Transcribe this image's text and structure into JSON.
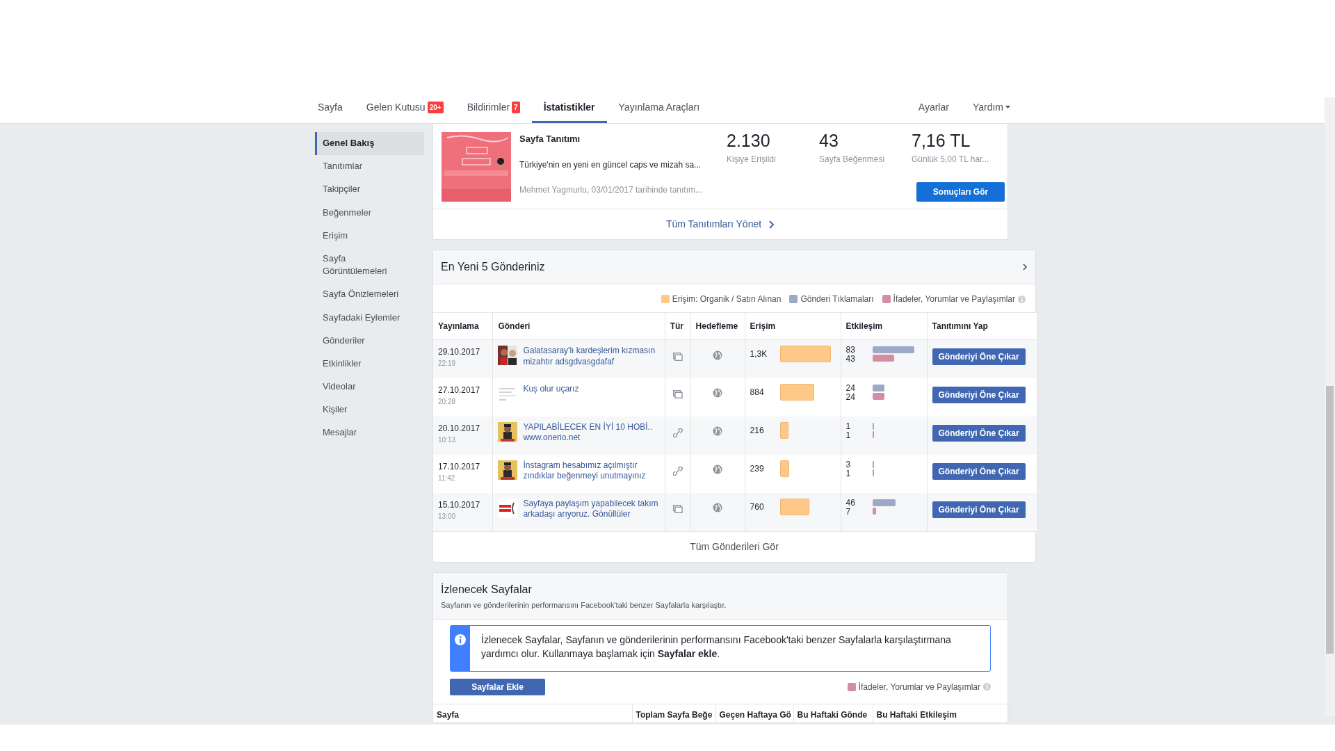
{
  "nav": {
    "tabs": [
      {
        "label": "Sayfa",
        "selected": false
      },
      {
        "label": "Gelen Kutusu",
        "badge": "20+",
        "selected": false
      },
      {
        "label": "Bildirimler",
        "badge": "7",
        "selected": false
      },
      {
        "label": "İstatistikler",
        "selected": true
      },
      {
        "label": "Yayınlama Araçları",
        "selected": false
      }
    ],
    "right": [
      {
        "label": "Ayarlar",
        "dropdown": false
      },
      {
        "label": "Yardım",
        "dropdown": true
      }
    ]
  },
  "sidebar": {
    "items": [
      {
        "label": "Genel Bakış",
        "selected": true
      },
      {
        "label": "Tanıtımlar",
        "selected": false
      },
      {
        "label": "Takipçiler",
        "selected": false
      },
      {
        "label": "Beğenmeler",
        "selected": false
      },
      {
        "label": "Erişim",
        "selected": false
      },
      {
        "label": "Sayfa Görüntülemeleri",
        "selected": false
      },
      {
        "label": "Sayfa Önizlemeleri",
        "selected": false
      },
      {
        "label": "Sayfadaki Eylemler",
        "selected": false
      },
      {
        "label": "Gönderiler",
        "selected": false
      },
      {
        "label": "Etkinlikler",
        "selected": false
      },
      {
        "label": "Videolar",
        "selected": false
      },
      {
        "label": "Kişiler",
        "selected": false
      },
      {
        "label": "Mesajlar",
        "selected": false
      }
    ]
  },
  "promotion": {
    "title": "Sayfa Tanıtımı",
    "description": "Türkiye'nin en yeni en güncel caps ve mizah sa...",
    "author": "Mehmet Yagmurlu, 03/01/2017 tarihinde tanıtım...",
    "stats": [
      {
        "value": "2.130",
        "label": "Kişiye Erişildi"
      },
      {
        "value": "43",
        "label": "Sayfa Beğenmesi"
      },
      {
        "value": "7,16 TL",
        "label": "Günlük 5,00 TL har..."
      }
    ],
    "button": "Sonuçları Gör",
    "footer_link": "Tüm Tanıtımları Yönet"
  },
  "posts": {
    "title": "En Yeni 5 Gönderiniz",
    "legend": [
      {
        "label": "Erişim: Organik / Satın Alınan",
        "color": "#fdc888"
      },
      {
        "label": "Gönderi Tıklamaları",
        "color": "#9caac8"
      },
      {
        "label": "İfadeler, Yorumlar ve Paylaşımlar",
        "color": "#d48ea3"
      }
    ],
    "columns": [
      "Yayınlama",
      "Gönderi",
      "Tür",
      "Hedefleme",
      "Erişim",
      "Etkileşim",
      "Tanıtımını Yap"
    ],
    "rows": [
      {
        "date": "29.10.2017",
        "time": "22:19",
        "text": "Galatasaray'lı kardeşlerim kızmasın mizahtır adsgdvasgdafaf",
        "kind": "album",
        "reach": {
          "value": "1,3K"
        },
        "engagement": [
          {
            "value": "83"
          },
          {
            "value": "43"
          }
        ],
        "button": "Gönderiyi Öne Çıkar"
      },
      {
        "date": "27.10.2017",
        "time": "20:28",
        "text": "Kuş olur uçarız",
        "kind": "album",
        "reach": {
          "value": "884"
        },
        "engagement": [
          {
            "value": "24"
          },
          {
            "value": "24"
          }
        ],
        "button": "Gönderiyi Öne Çıkar"
      },
      {
        "date": "20.10.2017",
        "time": "10:13",
        "text": "YAPILABİLECEK EN İYİ 10 HOBİ..",
        "link": "www.onerio.net",
        "kind": "link",
        "reach": {
          "value": "216"
        },
        "engagement": [
          {
            "value": "1"
          },
          {
            "value": "1"
          }
        ],
        "button": "Gönderiyi Öne Çıkar"
      },
      {
        "date": "17.10.2017",
        "time": "11:42",
        "text": "İnstagram hesabımız açılmıştır zındıklar beğenmeyi unutmayınız",
        "kind": "link",
        "reach": {
          "value": "239"
        },
        "engagement": [
          {
            "value": "3"
          },
          {
            "value": "1"
          }
        ],
        "button": "Gönderiyi Öne Çıkar"
      },
      {
        "date": "15.10.2017",
        "time": "13:00",
        "text": "Sayfaya paylaşım yapabilecek takım arkadaşı arıyoruz. Gönüllüler",
        "kind": "album",
        "reach": {
          "value": "760"
        },
        "engagement": [
          {
            "value": "46"
          },
          {
            "value": "7"
          }
        ],
        "button": "Gönderiyi Öne Çıkar"
      }
    ],
    "footer_link": "Tüm Gönderileri Gör"
  },
  "watch": {
    "title": "İzlenecek Sayfalar",
    "subtitle": "Sayfanın ve gönderilerinin performansını Facebook'taki benzer Sayfalarla karşılaştır.",
    "info": "İzlenecek Sayfalar, Sayfanın ve gönderilerinin performansını Facebook'taki benzer Sayfalarla karşılaştırmana yardımcı olur. Kullanmaya başlamak için **Sayfalar ekle**.",
    "button": "Sayfalar Ekle",
    "legend": {
      "label": "İfadeler, Yorumlar ve Paylaşımlar",
      "color": "#d48ea3"
    },
    "columns": [
      "Sayfa",
      "Toplam Sayfa Beğe",
      "Geçen Haftaya Gö",
      "Bu Haftaki Gönde",
      "Bu Haftaki Etkileşim"
    ]
  }
}
